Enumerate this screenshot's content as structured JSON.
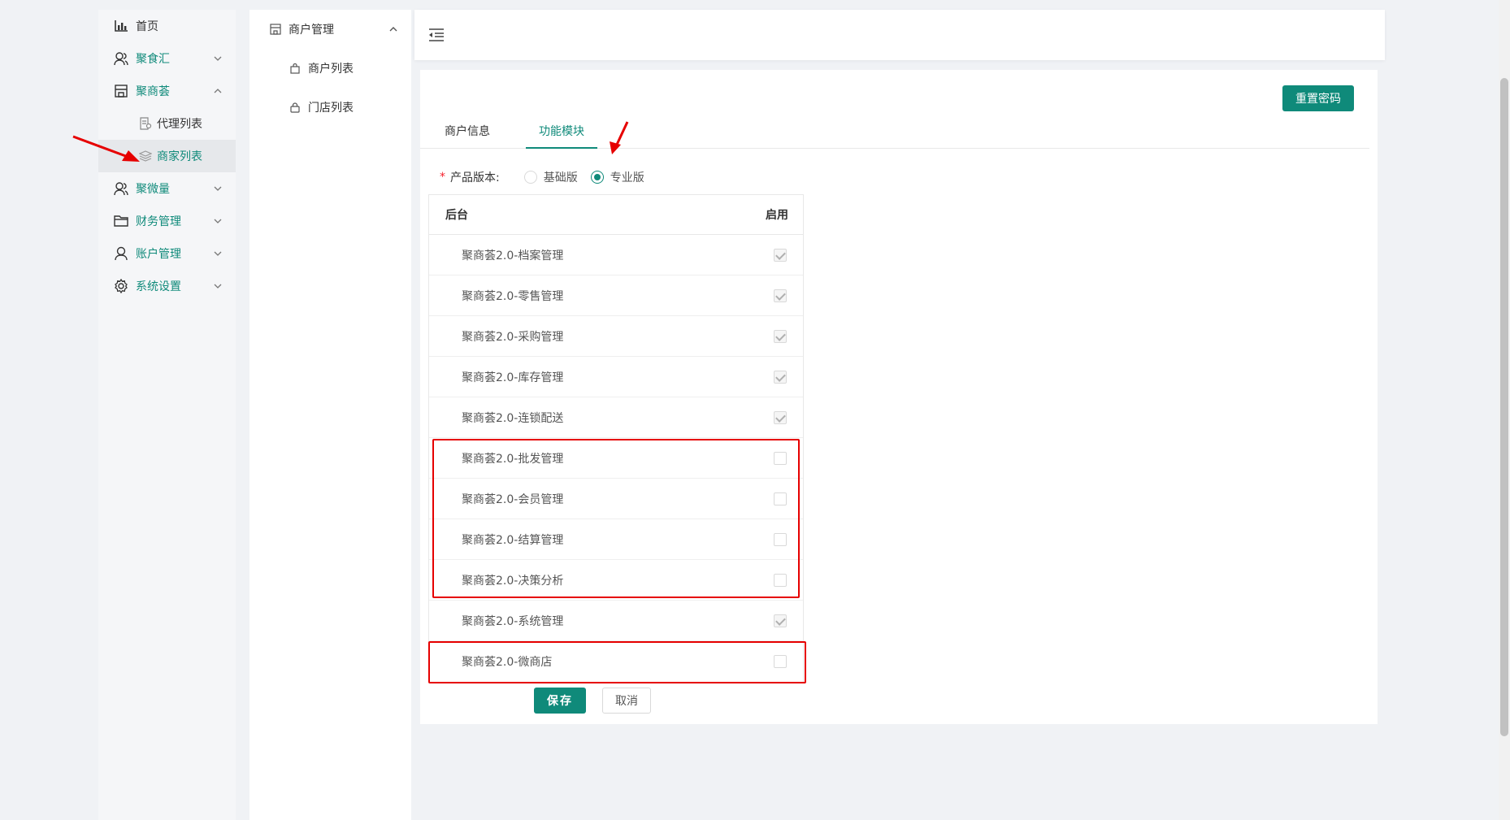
{
  "sidebar": {
    "items": [
      {
        "label": "首页",
        "icon": "chart-icon"
      },
      {
        "label": "聚食汇",
        "icon": "user-icon"
      },
      {
        "label": "聚商荟",
        "icon": "store-icon"
      },
      {
        "label": "代理列表",
        "icon": "document-icon"
      },
      {
        "label": "商家列表",
        "icon": "layers-icon"
      },
      {
        "label": "聚微量",
        "icon": "user-icon"
      },
      {
        "label": "财务管理",
        "icon": "folder-icon"
      },
      {
        "label": "账户管理",
        "icon": "person-icon"
      },
      {
        "label": "系统设置",
        "icon": "gear-icon"
      }
    ]
  },
  "sidebar2": {
    "header": "商户管理",
    "items": [
      {
        "label": "商户列表"
      },
      {
        "label": "门店列表"
      }
    ]
  },
  "actions": {
    "reset_password": "重置密码",
    "save": "保存",
    "cancel": "取消"
  },
  "tabs": [
    {
      "label": "商户信息"
    },
    {
      "label": "功能模块",
      "active": true
    }
  ],
  "form": {
    "required_mark": "*",
    "version_label": "产品版本:",
    "options": [
      {
        "label": "基础版",
        "checked": false
      },
      {
        "label": "专业版",
        "checked": true
      }
    ]
  },
  "table": {
    "headers": {
      "name": "后台",
      "enabled": "启用"
    },
    "rows": [
      {
        "name": "聚商荟2.0-档案管理",
        "checked": true
      },
      {
        "name": "聚商荟2.0-零售管理",
        "checked": true
      },
      {
        "name": "聚商荟2.0-采购管理",
        "checked": true
      },
      {
        "name": "聚商荟2.0-库存管理",
        "checked": true
      },
      {
        "name": "聚商荟2.0-连锁配送",
        "checked": true
      },
      {
        "name": "聚商荟2.0-批发管理",
        "checked": false
      },
      {
        "name": "聚商荟2.0-会员管理",
        "checked": false
      },
      {
        "name": "聚商荟2.0-结算管理",
        "checked": false
      },
      {
        "name": "聚商荟2.0-决策分析",
        "checked": false
      },
      {
        "name": "聚商荟2.0-系统管理",
        "checked": true
      },
      {
        "name": "聚商荟2.0-微商店",
        "checked": false
      }
    ]
  },
  "colors": {
    "accent": "#0f8a7a",
    "annotation": "#e60000"
  }
}
